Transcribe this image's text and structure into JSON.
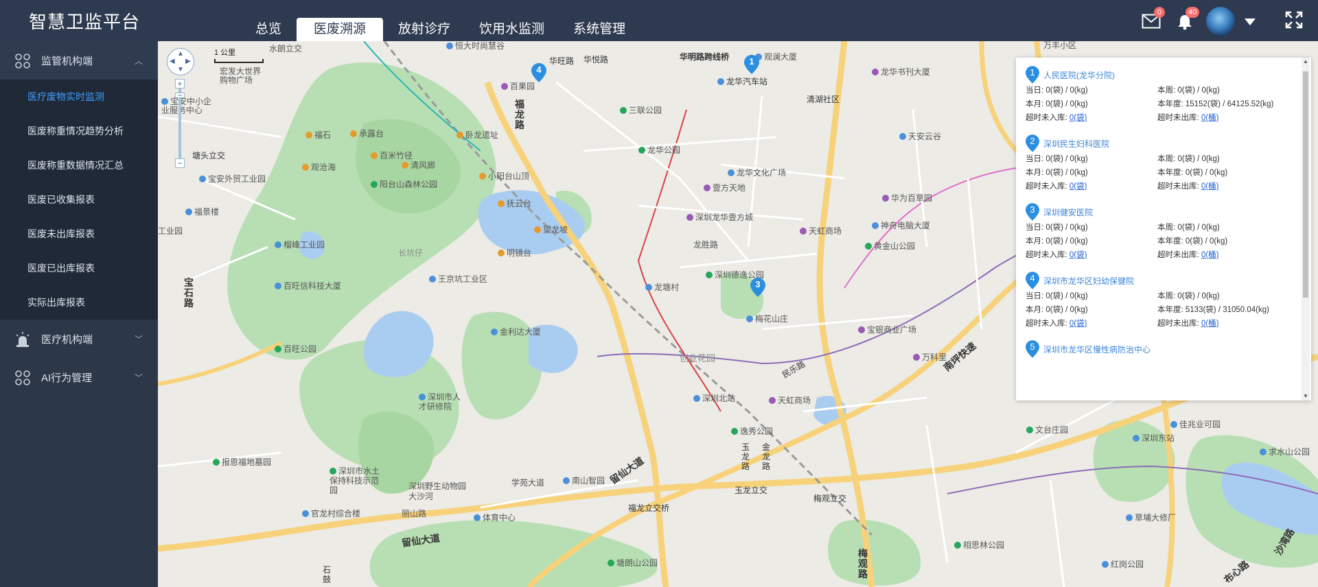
{
  "app": {
    "title": "智慧卫监平台"
  },
  "header": {
    "tabs": [
      {
        "label": "总览",
        "active": false
      },
      {
        "label": "医废溯源",
        "active": true
      },
      {
        "label": "放射诊疗",
        "active": false
      },
      {
        "label": "饮用水监测",
        "active": false
      },
      {
        "label": "系统管理",
        "active": false
      }
    ],
    "mail_badge": "0",
    "bell_badge": "40",
    "icons": [
      "mail-icon",
      "bell-icon",
      "avatar",
      "caret-down-icon",
      "fullscreen-icon"
    ]
  },
  "sidebar": {
    "groups": [
      {
        "label": "监管机构端",
        "icon": "dots-grid-icon",
        "open": true
      },
      {
        "label": "医疗机构端",
        "icon": "alarm-light-icon",
        "open": false
      },
      {
        "label": "AI行为管理",
        "icon": "dots-grid-icon",
        "open": false
      }
    ],
    "items": [
      {
        "label": "医疗废物实时监测",
        "active": true
      },
      {
        "label": "医废称重情况趋势分析",
        "active": false
      },
      {
        "label": "医废称重数据情况汇总",
        "active": false
      },
      {
        "label": "医废已收集报表",
        "active": false
      },
      {
        "label": "医废未出库报表",
        "active": false
      },
      {
        "label": "医废已出库报表",
        "active": false
      },
      {
        "label": "实际出库报表",
        "active": false
      }
    ]
  },
  "map": {
    "scale_label": "1 公里",
    "pins": [
      "1",
      "3",
      "4"
    ],
    "labels": [
      "水朗立交",
      "恒大时尚慧谷",
      "华明路跨线桥",
      "观澜大厦",
      "清湖社区",
      "龙华书刊大厦",
      "万丰小区",
      "宏发大世界购物广场",
      "百果园",
      "华旺路",
      "华悦路",
      "龙华汽车站",
      "宝安中小企业服务中心",
      "福石",
      "承露台",
      "卧龙遗址",
      "三联公园",
      "塘头立交",
      "观沧海",
      "百米竹径",
      "清风廊",
      "龙华公园",
      "壹方天地",
      "龙华文化广场",
      "天安云谷",
      "宝安外贸工业园",
      "阳台山森林公园",
      "小阳台山顶",
      "福龙路",
      "华为百草园",
      "神舟电脑大厦",
      "福景楼",
      "工业园",
      "抚云台",
      "望龙坡",
      "深圳龙华壹方城",
      "天虹商场",
      "黄金山公园",
      "榴峰工业园",
      "明镜台",
      "长坑仔",
      "龙胜路",
      "宝石路",
      "百旺信科技大厦",
      "王京坑工业区",
      "深圳德逸公园",
      "龙塘村",
      "梅花山庄",
      "百旺公园",
      "金利达大厦",
      "创业花园",
      "宝银商业广场",
      "万科里",
      "南坪快速",
      "深圳市人才研修院",
      "深圳北站",
      "天虹商场",
      "民乐路",
      "报恩福地墓园",
      "逸秀公园",
      "玉龙路",
      "金龙路",
      "文台庄园",
      "深圳东站",
      "佳兆业可园",
      "深圳市水土保持科技示范园",
      "深圳野生动物园",
      "大沙河",
      "学苑大道",
      "南山智园",
      "留仙大道",
      "求水山公园",
      "体育中心",
      "官龙村综合楼",
      "丽山路",
      "福龙立交桥",
      "玉龙立交",
      "梅观立交",
      "草埔大修厂",
      "相思林公园",
      "留仙大道",
      "塘朗山公园",
      "红岗公园",
      "梅观路",
      "布心路",
      "沙湾路",
      "石鼓"
    ]
  },
  "panel": {
    "hospitals": [
      {
        "num": "1",
        "name": "人民医院(龙华分院)",
        "day": "当日: 0(袋) / 0(kg)",
        "week": "本周: 0(袋) / 0(kg)",
        "month": "本月: 0(袋) / 0(kg)",
        "year": "本年度: 15152(袋) / 64125.52(kg)",
        "in_label": "超时未入库: ",
        "in_value": "0(袋)",
        "out_label": "超时未出库: ",
        "out_value": "0(桶)"
      },
      {
        "num": "2",
        "name": "深圳民生妇科医院",
        "day": "当日: 0(袋) / 0(kg)",
        "week": "本周: 0(袋) / 0(kg)",
        "month": "本月: 0(袋) / 0(kg)",
        "year": "本年度: 0(袋) / 0(kg)",
        "in_label": "超时未入库: ",
        "in_value": "0(袋)",
        "out_label": "超时未出库: ",
        "out_value": "0(桶)"
      },
      {
        "num": "3",
        "name": "深圳健安医院",
        "day": "当日: 0(袋) / 0(kg)",
        "week": "本周: 0(袋) / 0(kg)",
        "month": "本月: 0(袋) / 0(kg)",
        "year": "本年度: 0(袋) / 0(kg)",
        "in_label": "超时未入库: ",
        "in_value": "0(袋)",
        "out_label": "超时未出库: ",
        "out_value": "0(桶)"
      },
      {
        "num": "4",
        "name": "深圳市龙华区妇幼保健院",
        "day": "当日: 0(袋) / 0(kg)",
        "week": "本周: 0(袋) / 0(kg)",
        "month": "本月: 0(袋) / 0(kg)",
        "year": "本年度: 5133(袋) / 31050.04(kg)",
        "in_label": "超时未入库: ",
        "in_value": "0(袋)",
        "out_label": "超时未出库: ",
        "out_value": "0(桶)"
      },
      {
        "num": "5",
        "name": "深圳市龙华区慢性病防治中心"
      }
    ]
  }
}
